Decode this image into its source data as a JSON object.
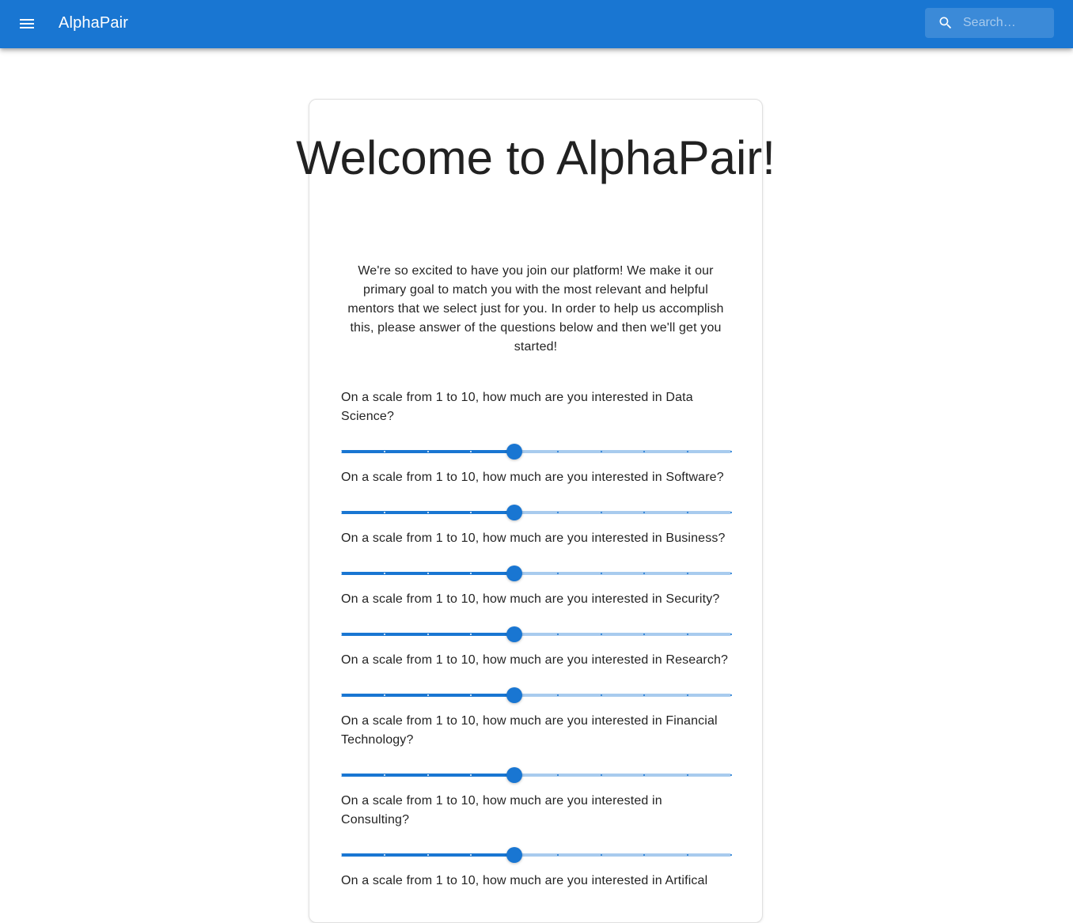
{
  "appbar": {
    "title": "AlphaPair",
    "menu_icon": "menu-icon",
    "search": {
      "placeholder": "Search…",
      "value": "",
      "icon": "search-icon"
    }
  },
  "colors": {
    "primary": "#1976d2",
    "text": "#212121"
  },
  "page": {
    "heading": "Welcome to AlphaPair!",
    "intro": "We're so excited to have you join our platform! We make it our primary goal to match you with the most relevant and helpful mentors that we select just for you. In order to help us accomplish this, please answer of the questions below and then we'll get you started!"
  },
  "questions": [
    {
      "label": "On a scale from 1 to 10, how much are you interested in Data Science?",
      "value": 5,
      "min": 1,
      "max": 10
    },
    {
      "label": "On a scale from 1 to 10, how much are you interested in Software?",
      "value": 5,
      "min": 1,
      "max": 10
    },
    {
      "label": "On a scale from 1 to 10, how much are you interested in Business?",
      "value": 5,
      "min": 1,
      "max": 10
    },
    {
      "label": "On a scale from 1 to 10, how much are you interested in Security?",
      "value": 5,
      "min": 1,
      "max": 10
    },
    {
      "label": "On a scale from 1 to 10, how much are you interested in Research?",
      "value": 5,
      "min": 1,
      "max": 10
    },
    {
      "label": "On a scale from 1 to 10, how much are you interested in Financial Technology?",
      "value": 5,
      "min": 1,
      "max": 10
    },
    {
      "label": "On a scale from 1 to 10, how much are you interested in Consulting?",
      "value": 5,
      "min": 1,
      "max": 10
    },
    {
      "label": "On a scale from 1 to 10, how much are you interested in Artifical",
      "value": null,
      "min": 1,
      "max": 10
    }
  ]
}
